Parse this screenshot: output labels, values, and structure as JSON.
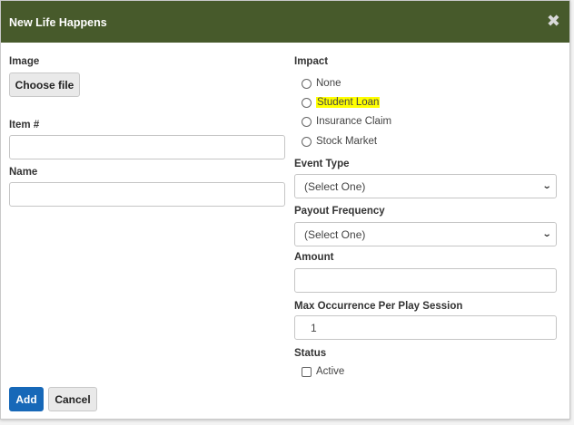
{
  "modal": {
    "title": "New Life Happens",
    "close_glyph": "✖"
  },
  "left": {
    "image_label": "Image",
    "choose_file_label": "Choose file",
    "item_label": "Item #",
    "item_value": "",
    "name_label": "Name",
    "name_value": ""
  },
  "right": {
    "impact_label": "Impact",
    "impact_options": [
      "None",
      "Student Loan",
      "Insurance Claim",
      "Stock Market"
    ],
    "impact_highlighted": "Student Loan",
    "event_type_label": "Event Type",
    "event_type_value": "(Select One)",
    "payout_frequency_label": "Payout Frequency",
    "payout_frequency_value": "(Select One)",
    "amount_label": "Amount",
    "amount_value": "",
    "max_occurrence_label": "Max Occurrence Per Play Session",
    "max_occurrence_value": "1",
    "status_label": "Status",
    "active_label": "Active"
  },
  "footer": {
    "add_label": "Add",
    "cancel_label": "Cancel"
  },
  "colors": {
    "header_bg": "#475a2b",
    "primary_button": "#1768b8",
    "highlight": "#ffff00"
  }
}
